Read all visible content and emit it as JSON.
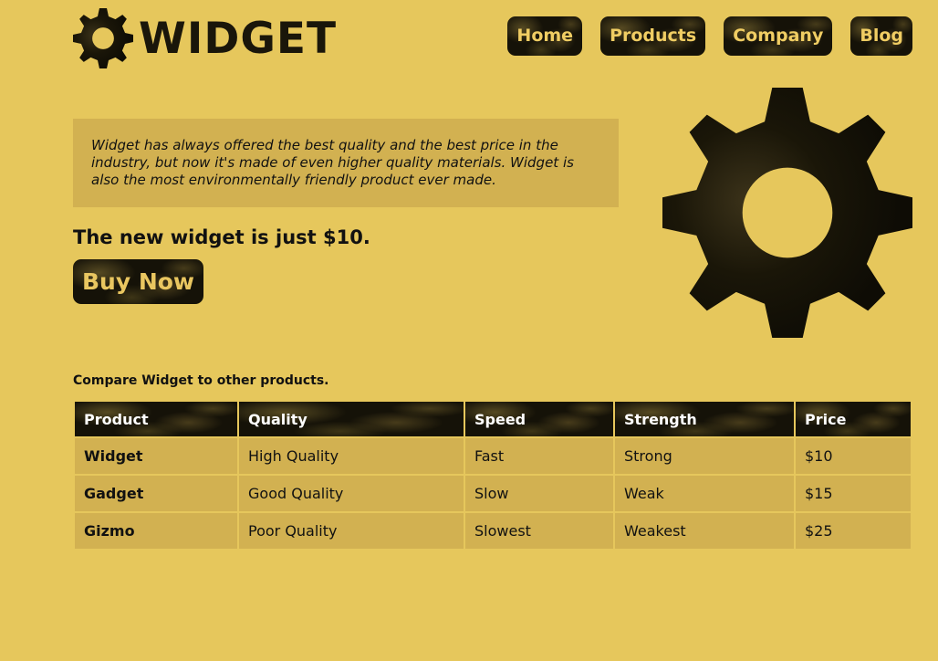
{
  "brand": {
    "logo_text": "WIDGET",
    "logo_icon": "gear-icon",
    "accent": "#e6c75c",
    "dark": "#151208"
  },
  "nav": {
    "items": [
      {
        "label": "Home"
      },
      {
        "label": "Products"
      },
      {
        "label": "Company"
      },
      {
        "label": "Blog"
      }
    ]
  },
  "intro": {
    "text": "Widget has always offered the best quality and the best price in the industry, but now it's made of even higher quality materials. Widget is also the most environmentally friendly product ever made."
  },
  "offer": {
    "text": "The new widget is just $10.",
    "buy_label": "Buy Now"
  },
  "hero_icon": "gear-icon",
  "compare": {
    "label": "Compare Widget to other products.",
    "headers": [
      "Product",
      "Quality",
      "Speed",
      "Strength",
      "Price"
    ],
    "rows": [
      [
        "Widget",
        "High Quality",
        "Fast",
        "Strong",
        "$10"
      ],
      [
        "Gadget",
        "Good Quality",
        "Slow",
        "Weak",
        "$15"
      ],
      [
        "Gizmo",
        "Poor Quality",
        "Slowest",
        "Weakest",
        "$25"
      ]
    ]
  }
}
